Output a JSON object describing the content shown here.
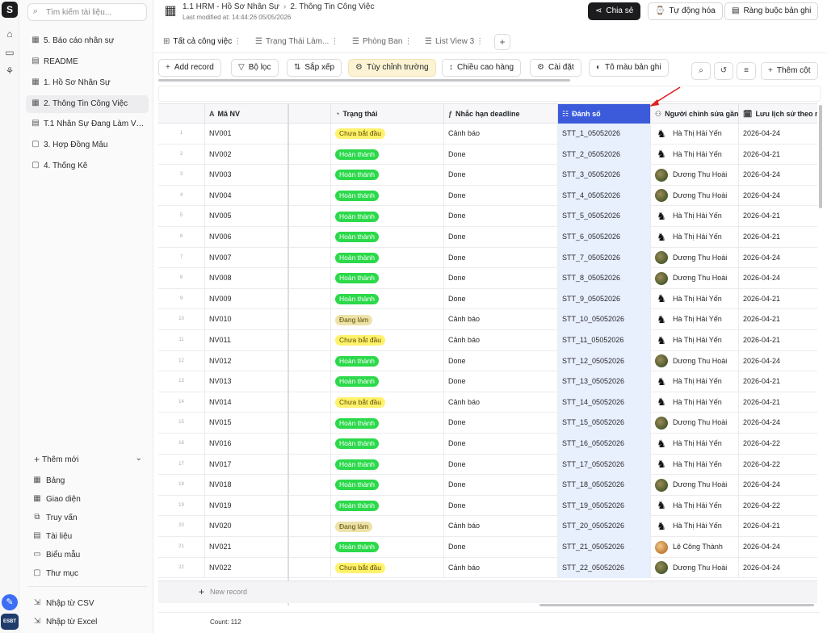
{
  "app": {
    "logo_glyph": "S",
    "badge_label": "ESBT"
  },
  "sidebar": {
    "search_placeholder": "Tìm kiếm tài liệu...",
    "items": [
      {
        "label": "5. Báo cáo nhân sự",
        "icon": "table-icon"
      },
      {
        "label": "README",
        "icon": "document-icon"
      },
      {
        "label": "1. Hồ Sơ Nhân Sự",
        "icon": "table-icon"
      },
      {
        "label": "2. Thông Tin Công Việc",
        "icon": "table-icon",
        "active": true
      },
      {
        "label": "T.1 Nhân Sự Đang Làm Việc",
        "icon": "document-icon"
      },
      {
        "label": "3. Hợp Đồng Mẫu",
        "icon": "folder-icon"
      },
      {
        "label": "4. Thống Kê",
        "icon": "folder-icon"
      }
    ],
    "add_new_label": "Thêm mới",
    "add_items": [
      {
        "label": "Bảng",
        "icon": "table-icon"
      },
      {
        "label": "Giao diện",
        "icon": "layout-icon"
      },
      {
        "label": "Truy vấn",
        "icon": "query-icon"
      },
      {
        "label": "Tài liệu",
        "icon": "document-icon"
      },
      {
        "label": "Biểu mẫu",
        "icon": "form-icon"
      },
      {
        "label": "Thư mục",
        "icon": "folder-icon"
      }
    ],
    "import_items": [
      {
        "label": "Nhập từ CSV",
        "icon": "import-icon"
      },
      {
        "label": "Nhập từ Excel",
        "icon": "import-icon"
      }
    ]
  },
  "header": {
    "breadcrumb_parent": "1.1 HRM - Hồ Sơ Nhân Sự",
    "breadcrumb_current": "2. Thông Tin Công Việc",
    "modified_label": "Last modified at:",
    "modified_time": "14:44:26 05/05/2026",
    "share_label": "Chia sẻ",
    "automation_label": "Tự động hóa",
    "constraints_label": "Ràng buộc bản ghi"
  },
  "views": [
    {
      "label": "Tất cả công việc",
      "active": true
    },
    {
      "label": "Trạng Thái Làm..."
    },
    {
      "label": "Phòng Ban"
    },
    {
      "label": "List View 3"
    }
  ],
  "toolbar": {
    "add_record": "Add record",
    "filter": "Bộ lọc",
    "sort": "Sắp xếp",
    "customize_fields": "Tùy chỉnh trường",
    "row_height": "Chiều cao hàng",
    "settings": "Cài đặt",
    "color_records": "Tô màu bản ghi",
    "add_column": "Thêm cột"
  },
  "columns": [
    {
      "key": "ma",
      "label": "Mã NV",
      "icon": "text-icon"
    },
    {
      "key": "blank",
      "label": "",
      "icon": ""
    },
    {
      "key": "trang_thai",
      "label": "Trạng thái",
      "icon": "status-icon"
    },
    {
      "key": "nhac_han",
      "label": "Nhắc hạn deadline",
      "icon": "formula-icon"
    },
    {
      "key": "danh_so",
      "label": "Đánh số",
      "icon": "autonumber-icon",
      "selected": true
    },
    {
      "key": "nguoi_sua",
      "label": "Người chỉnh sửa gần nhất",
      "icon": "user-edit-icon"
    },
    {
      "key": "luu_lich_su",
      "label": "Lưu lịch sử theo ngày",
      "icon": "history-icon"
    }
  ],
  "status_colors": {
    "Chưa bắt đầu": {
      "bg": "#fff26b",
      "fg": "#5a4a00"
    },
    "Hoàn thành": {
      "bg": "#2bd94a",
      "fg": "#ffffff"
    },
    "Đang làm": {
      "bg": "#ede2a8",
      "fg": "#5a4a00"
    }
  },
  "rows": [
    {
      "idx": "1",
      "ma": "NV001",
      "trang_thai": "Chưa bắt đầu",
      "nhac_han": "Cảnh báo",
      "danh_so": "STT_1_05052026",
      "nguoi_sua": "Hà Thị Hải Yến",
      "avatar": "ha",
      "luu": "2026-04-24"
    },
    {
      "idx": "2",
      "ma": "NV002",
      "trang_thai": "Hoàn thành",
      "nhac_han": "Done",
      "danh_so": "STT_2_05052026",
      "nguoi_sua": "Hà Thị Hải Yến",
      "avatar": "ha",
      "luu": "2026-04-21"
    },
    {
      "idx": "3",
      "ma": "NV003",
      "trang_thai": "Hoàn thành",
      "nhac_han": "Done",
      "danh_so": "STT_3_05052026",
      "nguoi_sua": "Dương Thu Hoài",
      "avatar": "duong",
      "luu": "2026-04-24"
    },
    {
      "idx": "4",
      "ma": "NV004",
      "trang_thai": "Hoàn thành",
      "nhac_han": "Done",
      "danh_so": "STT_4_05052026",
      "nguoi_sua": "Dương Thu Hoài",
      "avatar": "duong",
      "luu": "2026-04-24"
    },
    {
      "idx": "5",
      "ma": "NV005",
      "trang_thai": "Hoàn thành",
      "nhac_han": "Done",
      "danh_so": "STT_5_05052026",
      "nguoi_sua": "Hà Thị Hải Yến",
      "avatar": "ha",
      "luu": "2026-04-21"
    },
    {
      "idx": "6",
      "ma": "NV006",
      "trang_thai": "Hoàn thành",
      "nhac_han": "Done",
      "danh_so": "STT_6_05052026",
      "nguoi_sua": "Hà Thị Hải Yến",
      "avatar": "ha",
      "luu": "2026-04-21"
    },
    {
      "idx": "7",
      "ma": "NV007",
      "trang_thai": "Hoàn thành",
      "nhac_han": "Done",
      "danh_so": "STT_7_05052026",
      "nguoi_sua": "Dương Thu Hoài",
      "avatar": "duong",
      "luu": "2026-04-24"
    },
    {
      "idx": "8",
      "ma": "NV008",
      "trang_thai": "Hoàn thành",
      "nhac_han": "Done",
      "danh_so": "STT_8_05052026",
      "nguoi_sua": "Dương Thu Hoài",
      "avatar": "duong",
      "luu": "2026-04-24"
    },
    {
      "idx": "9",
      "ma": "NV009",
      "trang_thai": "Hoàn thành",
      "nhac_han": "Done",
      "danh_so": "STT_9_05052026",
      "nguoi_sua": "Hà Thị Hải Yến",
      "avatar": "ha",
      "luu": "2026-04-21"
    },
    {
      "idx": "10",
      "ma": "NV010",
      "trang_thai": "Đang làm",
      "nhac_han": "Cảnh báo",
      "danh_so": "STT_10_05052026",
      "nguoi_sua": "Hà Thị Hải Yến",
      "avatar": "ha",
      "luu": "2026-04-21"
    },
    {
      "idx": "11",
      "ma": "NV011",
      "trang_thai": "Chưa bắt đầu",
      "nhac_han": "Cảnh báo",
      "danh_so": "STT_11_05052026",
      "nguoi_sua": "Hà Thị Hải Yến",
      "avatar": "ha",
      "luu": "2026-04-21"
    },
    {
      "idx": "12",
      "ma": "NV012",
      "trang_thai": "Hoàn thành",
      "nhac_han": "Done",
      "danh_so": "STT_12_05052026",
      "nguoi_sua": "Dương Thu Hoài",
      "avatar": "duong",
      "luu": "2026-04-24"
    },
    {
      "idx": "13",
      "ma": "NV013",
      "trang_thai": "Hoàn thành",
      "nhac_han": "Done",
      "danh_so": "STT_13_05052026",
      "nguoi_sua": "Hà Thị Hải Yến",
      "avatar": "ha",
      "luu": "2026-04-21"
    },
    {
      "idx": "14",
      "ma": "NV014",
      "trang_thai": "Chưa bắt đầu",
      "nhac_han": "Cảnh báo",
      "danh_so": "STT_14_05052026",
      "nguoi_sua": "Hà Thị Hải Yến",
      "avatar": "ha",
      "luu": "2026-04-21"
    },
    {
      "idx": "15",
      "ma": "NV015",
      "trang_thai": "Hoàn thành",
      "nhac_han": "Done",
      "danh_so": "STT_15_05052026",
      "nguoi_sua": "Dương Thu Hoài",
      "avatar": "duong",
      "luu": "2026-04-24"
    },
    {
      "idx": "16",
      "ma": "NV016",
      "trang_thai": "Hoàn thành",
      "nhac_han": "Done",
      "danh_so": "STT_16_05052026",
      "nguoi_sua": "Hà Thị Hải Yến",
      "avatar": "ha",
      "luu": "2026-04-22"
    },
    {
      "idx": "17",
      "ma": "NV017",
      "trang_thai": "Hoàn thành",
      "nhac_han": "Done",
      "danh_so": "STT_17_05052026",
      "nguoi_sua": "Hà Thị Hải Yến",
      "avatar": "ha",
      "luu": "2026-04-22"
    },
    {
      "idx": "18",
      "ma": "NV018",
      "trang_thai": "Hoàn thành",
      "nhac_han": "Done",
      "danh_so": "STT_18_05052026",
      "nguoi_sua": "Dương Thu Hoài",
      "avatar": "duong",
      "luu": "2026-04-24"
    },
    {
      "idx": "19",
      "ma": "NV019",
      "trang_thai": "Hoàn thành",
      "nhac_han": "Done",
      "danh_so": "STT_19_05052026",
      "nguoi_sua": "Hà Thị Hải Yến",
      "avatar": "ha",
      "luu": "2026-04-22"
    },
    {
      "idx": "20",
      "ma": "NV020",
      "trang_thai": "Đang làm",
      "nhac_han": "Cảnh báo",
      "danh_so": "STT_20_05052026",
      "nguoi_sua": "Hà Thị Hải Yến",
      "avatar": "ha",
      "luu": "2026-04-21"
    },
    {
      "idx": "21",
      "ma": "NV021",
      "trang_thai": "Hoàn thành",
      "nhac_han": "Done",
      "danh_so": "STT_21_05052026",
      "nguoi_sua": "Lê Công Thành",
      "avatar": "le",
      "luu": "2026-04-24"
    },
    {
      "idx": "22",
      "ma": "NV022",
      "trang_thai": "Chưa bắt đầu",
      "nhac_han": "Cảnh báo",
      "danh_so": "STT_22_05052026",
      "nguoi_sua": "Dương Thu Hoài",
      "avatar": "duong",
      "luu": "2026-04-24"
    }
  ],
  "footer": {
    "new_record": "New record",
    "count_label": "Count: 112"
  }
}
